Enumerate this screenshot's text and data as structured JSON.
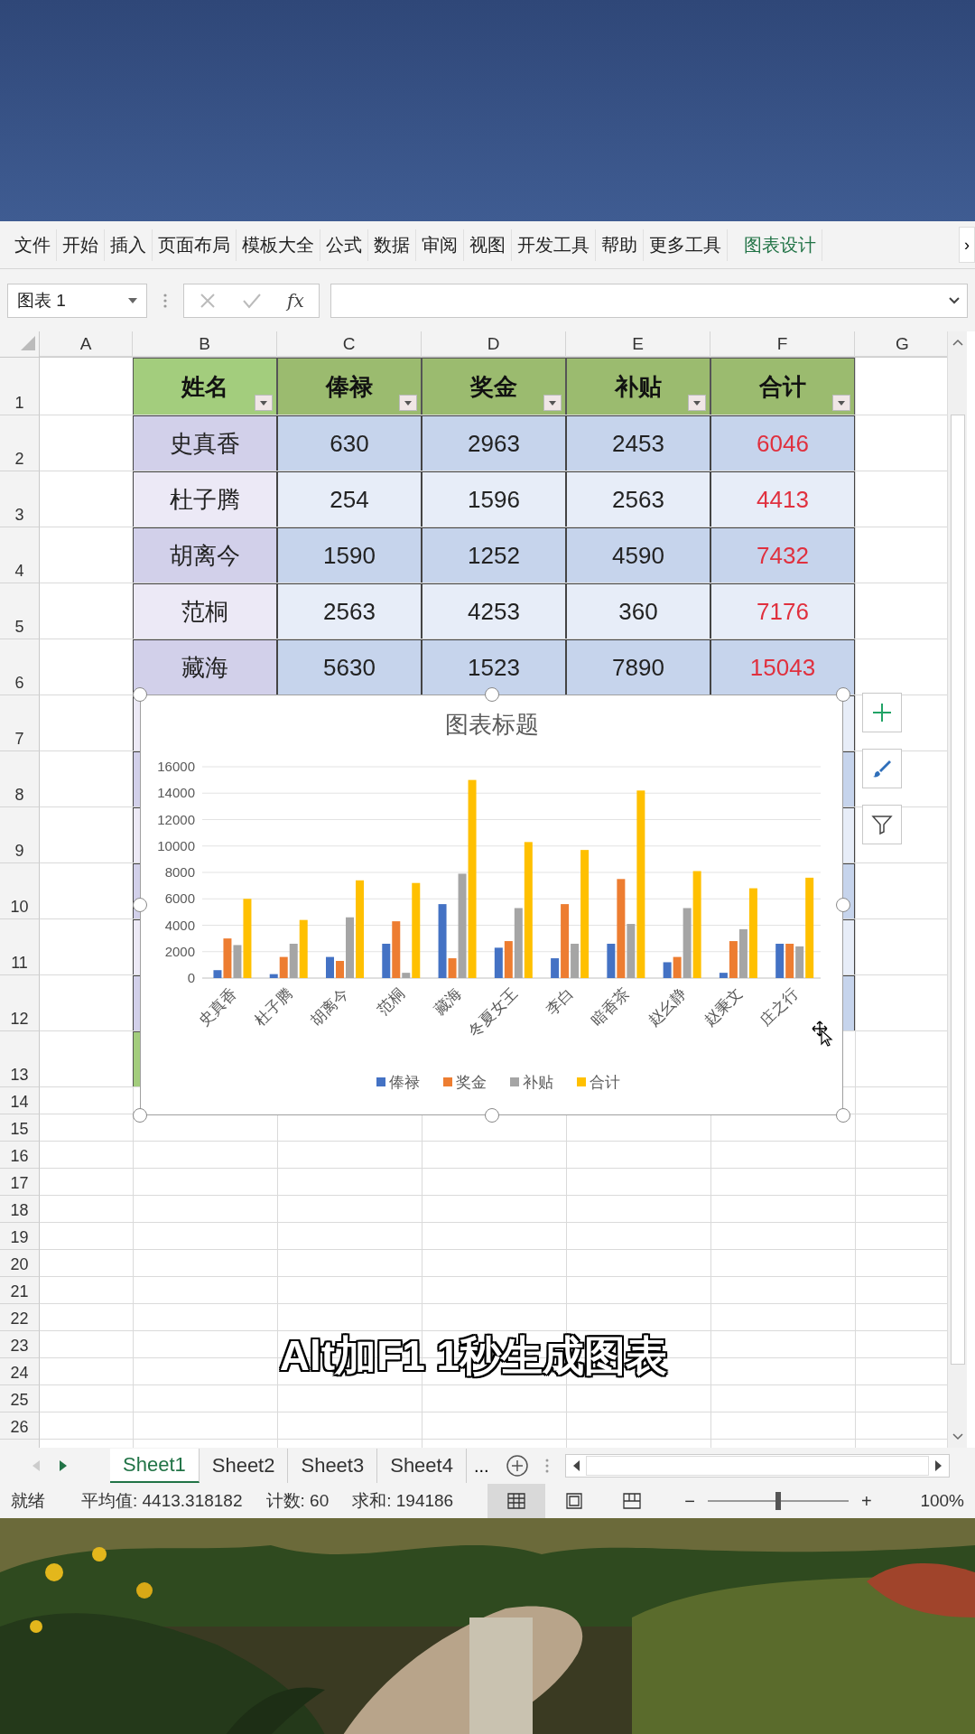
{
  "ribbon": {
    "tabs": [
      {
        "label": "文件",
        "selected": false
      },
      {
        "label": "开始",
        "selected": false
      },
      {
        "label": "插入",
        "selected": false
      },
      {
        "label": "页面布局",
        "selected": false
      },
      {
        "label": "模板大全",
        "selected": false
      },
      {
        "label": "公式",
        "selected": false
      },
      {
        "label": "数据",
        "selected": false
      },
      {
        "label": "审阅",
        "selected": false
      },
      {
        "label": "视图",
        "selected": false
      },
      {
        "label": "开发工具",
        "selected": false
      },
      {
        "label": "帮助",
        "selected": false
      },
      {
        "label": "更多工具",
        "selected": false
      },
      {
        "label": "图表设计",
        "selected": true
      }
    ],
    "more": "›"
  },
  "formula_bar": {
    "name_box": "图表 1",
    "function_label": "fx"
  },
  "sheet": {
    "columns": [
      "A",
      "B",
      "C",
      "D",
      "E",
      "F",
      "G"
    ],
    "row_numbers": [
      "1",
      "2",
      "3",
      "4",
      "5",
      "6",
      "7",
      "8",
      "9",
      "10",
      "11",
      "12",
      "13",
      "14",
      "15",
      "16",
      "17",
      "18",
      "19",
      "20",
      "21",
      "22",
      "23",
      "24",
      "25",
      "26"
    ],
    "table": {
      "headers": [
        "姓名",
        "俸禄",
        "奖金",
        "补贴",
        "合计"
      ],
      "rows": [
        {
          "name": "史真香",
          "cells": [
            "630",
            "2963",
            "2453",
            "6046"
          ]
        },
        {
          "name": "杜子腾",
          "cells": [
            "254",
            "1596",
            "2563",
            "4413"
          ]
        },
        {
          "name": "胡离今",
          "cells": [
            "1590",
            "1252",
            "4590",
            "7432"
          ]
        },
        {
          "name": "范桐",
          "cells": [
            "2563",
            "4253",
            "360",
            "7176"
          ]
        },
        {
          "name": "藏海",
          "cells": [
            "5630",
            "1523",
            "7890",
            "15043"
          ]
        }
      ]
    }
  },
  "chart": {
    "chart_data": {
      "type": "bar",
      "title": "图表标题",
      "categories": [
        "史真香",
        "杜子腾",
        "胡离今",
        "范桐",
        "藏海",
        "冬夏女王",
        "李白",
        "暗香茶",
        "赵幺静",
        "赵秉文",
        "庄之行"
      ],
      "series": [
        {
          "name": "俸禄",
          "color": "#4472c4",
          "values": [
            600,
            300,
            1600,
            2600,
            5600,
            2300,
            1500,
            2600,
            1200,
            400,
            2600
          ]
        },
        {
          "name": "奖金",
          "color": "#ed7d31",
          "values": [
            3000,
            1600,
            1300,
            4300,
            1500,
            2800,
            5600,
            7500,
            1600,
            2800,
            2600
          ]
        },
        {
          "name": "补贴",
          "color": "#a5a5a5",
          "values": [
            2500,
            2600,
            4600,
            400,
            7900,
            5300,
            2600,
            4100,
            5300,
            3700,
            2400
          ]
        },
        {
          "name": "合计",
          "color": "#ffc000",
          "values": [
            6000,
            4400,
            7400,
            7200,
            15000,
            10300,
            9700,
            14200,
            8100,
            6800,
            7600
          ]
        }
      ],
      "ylim": [
        0,
        16000
      ],
      "yticks": [
        0,
        2000,
        4000,
        6000,
        8000,
        10000,
        12000,
        14000,
        16000
      ],
      "grid": true,
      "legend": "bottom"
    }
  },
  "caption": "Alt加F1 1秒生成图表",
  "sheet_tabs": [
    {
      "label": "Sheet1",
      "selected": true
    },
    {
      "label": "Sheet2",
      "selected": false
    },
    {
      "label": "Sheet3",
      "selected": false
    },
    {
      "label": "Sheet4",
      "selected": false
    }
  ],
  "more_tabs": "...",
  "status_bar": {
    "ready": "就绪",
    "average": "平均值: 4413.318182",
    "count": "计数: 60",
    "sum": "求和: 194186",
    "views": [
      {
        "kind": "normal",
        "selected": true
      },
      {
        "kind": "page_layout",
        "selected": false
      },
      {
        "kind": "page_break",
        "selected": false
      }
    ],
    "zoom_out": "−",
    "zoom_in": "+",
    "zoom_slider": {
      "level": 0.5
    },
    "zoom": "100%"
  }
}
